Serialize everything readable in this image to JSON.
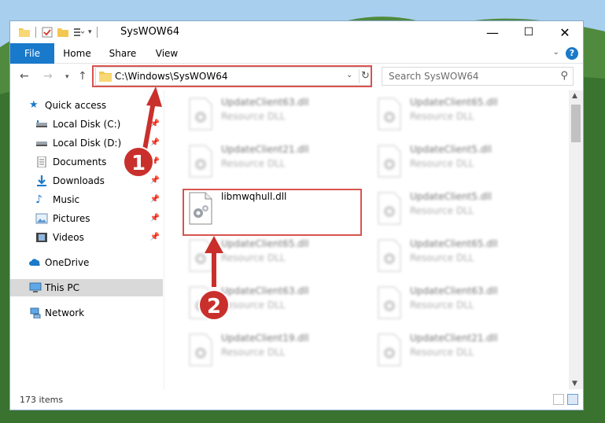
{
  "window": {
    "title": "SysWOW64",
    "controls": {
      "minimize": "—",
      "maximize": "☐",
      "close": "✕"
    }
  },
  "ribbon": {
    "tabs": [
      "File",
      "Home",
      "Share",
      "View"
    ],
    "help": "?"
  },
  "navigation": {
    "address_path": "C:\\Windows\\SysWOW64",
    "search_placeholder": "Search SysWOW64"
  },
  "sidebar": {
    "items": [
      {
        "label": "Quick access",
        "icon": "star-icon"
      },
      {
        "label": "Local Disk (C:)",
        "icon": "drive-icon",
        "pinned": true
      },
      {
        "label": "Local Disk (D:)",
        "icon": "drive-icon",
        "pinned": true
      },
      {
        "label": "Documents",
        "icon": "documents-icon",
        "pinned": true
      },
      {
        "label": "Downloads",
        "icon": "downloads-icon",
        "pinned": true
      },
      {
        "label": "Music",
        "icon": "music-icon",
        "pinned": true
      },
      {
        "label": "Pictures",
        "icon": "pictures-icon",
        "pinned": true
      },
      {
        "label": "Videos",
        "icon": "videos-icon",
        "pinned": true
      },
      {
        "label": "OneDrive",
        "icon": "cloud-icon"
      },
      {
        "label": "This PC",
        "icon": "computer-icon",
        "selected": true
      },
      {
        "label": "Network",
        "icon": "network-icon"
      }
    ]
  },
  "files": {
    "left_column": [
      {
        "name": "UpdateClient63.dll",
        "type": "Resource DLL"
      },
      {
        "name": "UpdateClient21.dll",
        "type": "Resource DLL"
      },
      {
        "name": "libmwqhull.dll",
        "type": ""
      },
      {
        "name": "UpdateClient65.dll",
        "type": "Resource DLL"
      },
      {
        "name": "UpdateClient63.dll",
        "type": "Resource DLL"
      },
      {
        "name": "UpdateClient19.dll",
        "type": "Resource DLL"
      }
    ],
    "right_column": [
      {
        "name": "UpdateClient65.dll",
        "type": "Resource DLL"
      },
      {
        "name": "UpdateClient5.dll",
        "type": "Resource DLL"
      },
      {
        "name": "UpdateClient5.dll",
        "type": "Resource DLL"
      },
      {
        "name": "UpdateClient65.dll",
        "type": "Resource DLL"
      },
      {
        "name": "UpdateClient63.dll",
        "type": "Resource DLL"
      },
      {
        "name": "UpdateClient21.dll",
        "type": "Resource DLL"
      }
    ]
  },
  "status": {
    "item_count": "173 items"
  },
  "annotations": {
    "step1": "1",
    "step2": "2",
    "color": "#d9534f"
  },
  "colors": {
    "accent": "#1979ca",
    "highlight": "#d9534f"
  }
}
